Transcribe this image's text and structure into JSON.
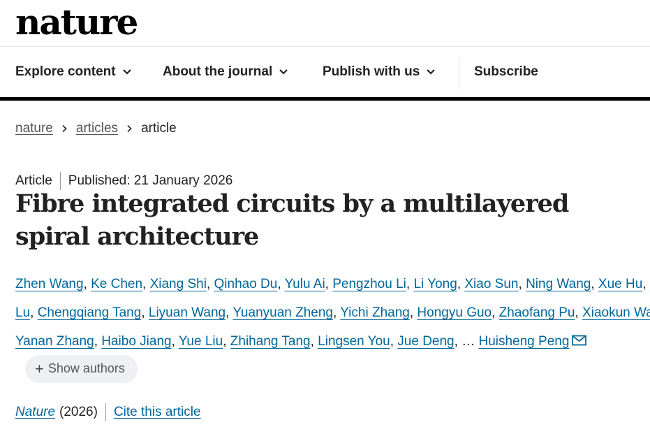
{
  "site": {
    "logo": "nature"
  },
  "nav": {
    "items": [
      {
        "label": "Explore content"
      },
      {
        "label": "About the journal"
      },
      {
        "label": "Publish with us"
      }
    ],
    "subscribe": "Subscribe"
  },
  "breadcrumb": {
    "items": [
      "nature",
      "articles",
      "article"
    ]
  },
  "article": {
    "type": "Article",
    "published": "Published: 21 January 2026",
    "title": "Fibre integrated circuits by a multilayered spiral architecture",
    "authors": [
      "Zhen Wang",
      "Ke Chen",
      "Xiang Shi",
      "Qinhao Du",
      "Yulu Ai",
      "Pengzhou Li",
      "Li Yong",
      "Xiao Sun",
      "Ning Wang",
      "Xue Hu",
      "Chen Lu",
      "Chengqiang Tang",
      "Liyuan Wang",
      "Yuanyuan Zheng",
      "Yichi Zhang",
      "Hongyu Guo",
      "Zhaofang Pu",
      "Xiaokun Wang",
      "Yanan Zhang",
      "Haibo Jiang",
      "Yue Liu",
      "Zhihang Tang",
      "Lingsen You",
      "Jue Deng"
    ],
    "ellipsis": "…",
    "last_author": "Huisheng Peng",
    "show_authors": "Show authors",
    "journal": "Nature",
    "year": "(2026)",
    "cite": "Cite this article"
  },
  "colors": {
    "link": "#006699",
    "nav_bar": "#000000",
    "chip_bg": "#eef0f3"
  },
  "icons": {
    "nav_chevron": "chevron-down-icon",
    "crumb_sep": "chevron-right-icon",
    "mail": "mail-icon",
    "plus": "plus-icon"
  }
}
